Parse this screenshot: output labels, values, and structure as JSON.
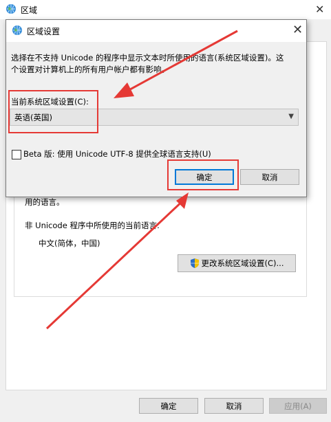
{
  "bg_window": {
    "title": "区域",
    "close_glyph": "✕",
    "partial_text": "用的语言。",
    "non_unicode_label": "非 Unicode 程序中所使用的当前语言:",
    "current_value": "中文(简体，中国)",
    "change_button": "更改系统区域设置(C)...",
    "ok_button": "确定",
    "cancel_button": "取消",
    "apply_button": "应用(A)"
  },
  "dialog": {
    "title": "区域设置",
    "close_glyph": "✕",
    "description_line1": "选择在不支持 Unicode 的程序中显示文本时所使用的语言(系统区域设置)。这",
    "description_line2": "个设置对计算机上的所有用户帐户都有影响。",
    "locale_label": "当前系统区域设置(C):",
    "locale_value": "英语(英国)",
    "beta_label": "Beta 版: 使用 Unicode UTF-8 提供全球语言支持(U)",
    "beta_checked": false,
    "ok_button": "确定",
    "cancel_button": "取消"
  },
  "colors": {
    "annotation_red": "#e53935",
    "primary_border": "#0078d7"
  },
  "icons": {
    "globe": "globe-icon",
    "shield": "uac-shield-icon"
  }
}
